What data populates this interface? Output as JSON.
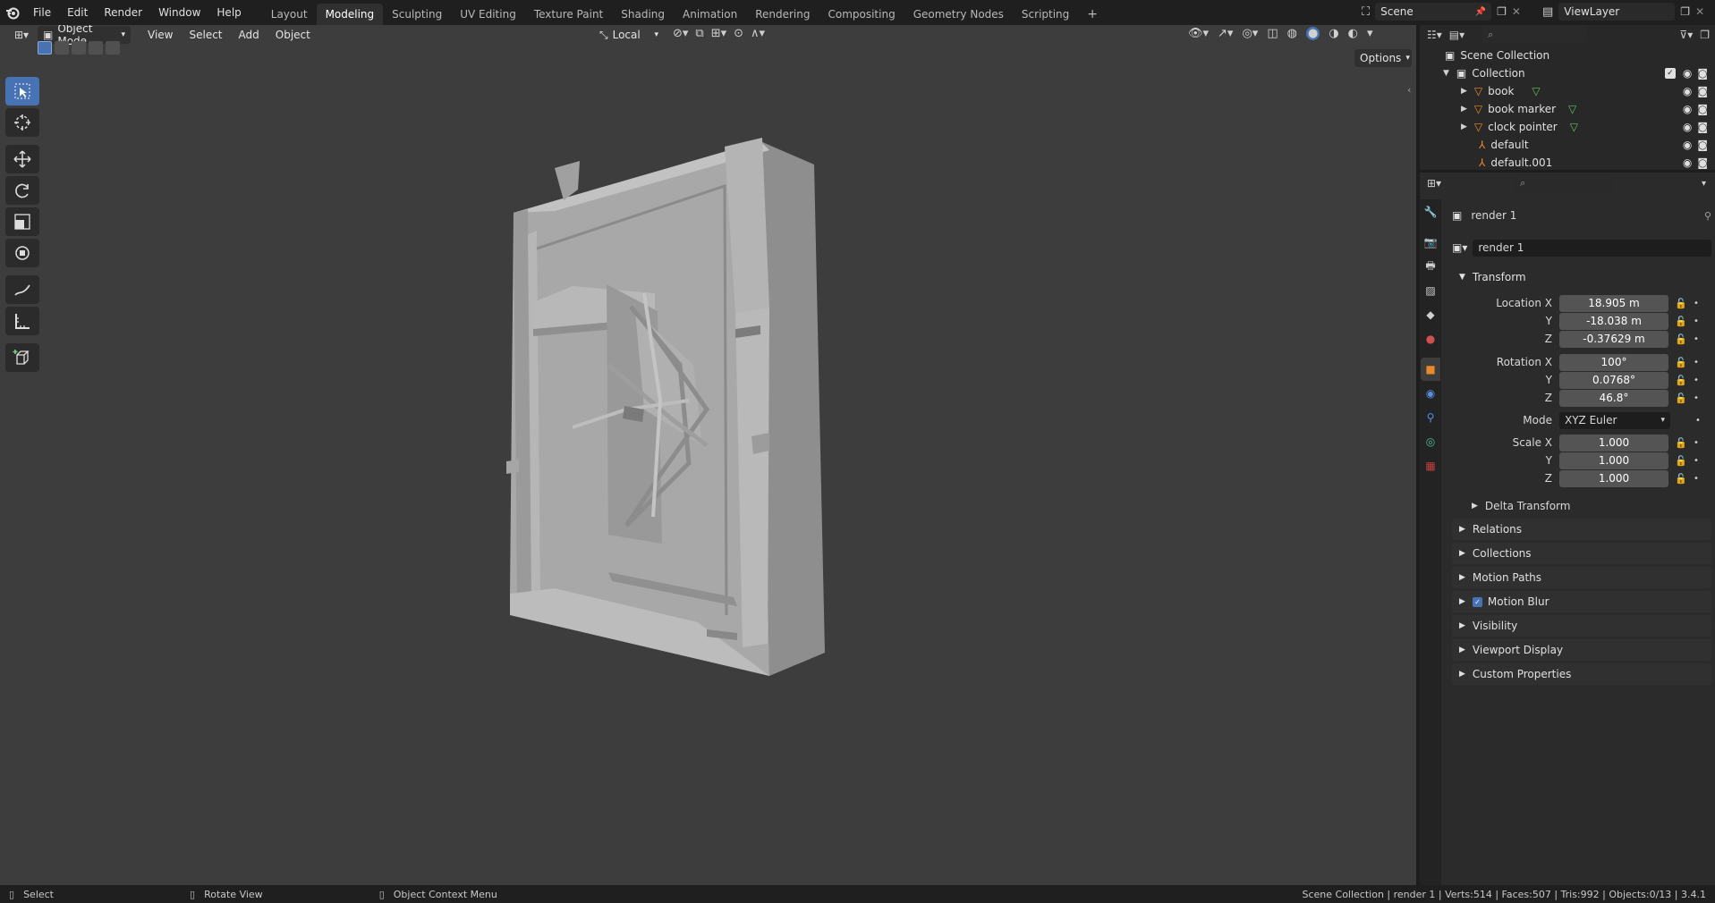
{
  "topbar": {
    "menus": [
      "File",
      "Edit",
      "Render",
      "Window",
      "Help"
    ],
    "workspaces": [
      "Layout",
      "Modeling",
      "Sculpting",
      "UV Editing",
      "Texture Paint",
      "Shading",
      "Animation",
      "Rendering",
      "Compositing",
      "Geometry Nodes",
      "Scripting"
    ],
    "active_workspace": "Modeling",
    "add_tab": "+",
    "scene": "Scene",
    "view_layer": "ViewLayer"
  },
  "viewport": {
    "mode": "Object Mode",
    "menus": [
      "View",
      "Select",
      "Add",
      "Object"
    ],
    "transform_orientation": "Local",
    "options": "Options"
  },
  "outliner": {
    "root": "Scene Collection",
    "collection": "Collection",
    "items": [
      {
        "name": "book",
        "type": "mesh"
      },
      {
        "name": "book marker",
        "type": "mesh"
      },
      {
        "name": "clock pointer",
        "type": "mesh"
      },
      {
        "name": "default",
        "type": "armature"
      },
      {
        "name": "default.001",
        "type": "armature"
      }
    ]
  },
  "properties": {
    "object_name": "render 1",
    "object_field": "render 1",
    "transform": {
      "header": "Transform",
      "location_label": "Location X",
      "location": [
        "18.905 m",
        "-18.038 m",
        "-0.37629 m"
      ],
      "rotation_label": "Rotation X",
      "rotation": [
        "100°",
        "0.0768°",
        "46.8°"
      ],
      "mode_label": "Mode",
      "mode": "XYZ Euler",
      "scale_label": "Scale X",
      "scale": [
        "1.000",
        "1.000",
        "1.000"
      ],
      "y_label": "Y",
      "z_label": "Z"
    },
    "delta_transform": "Delta Transform",
    "panels": [
      "Relations",
      "Collections",
      "Motion Paths",
      "Motion Blur",
      "Visibility",
      "Viewport Display",
      "Custom Properties"
    ],
    "motion_blur_checked": true
  },
  "statusbar": {
    "select": "Select",
    "rotate": "Rotate View",
    "context": "Object Context Menu",
    "info": "Scene Collection | render 1 | Verts:514 | Faces:507 | Tris:992 | Objects:0/13 | 3.4.1"
  },
  "colors": {
    "accent": "#4772b3",
    "viewport_bg": "#3d3d3d",
    "mesh_icon": "#e8892b",
    "data_icon": "#5fbf62"
  }
}
